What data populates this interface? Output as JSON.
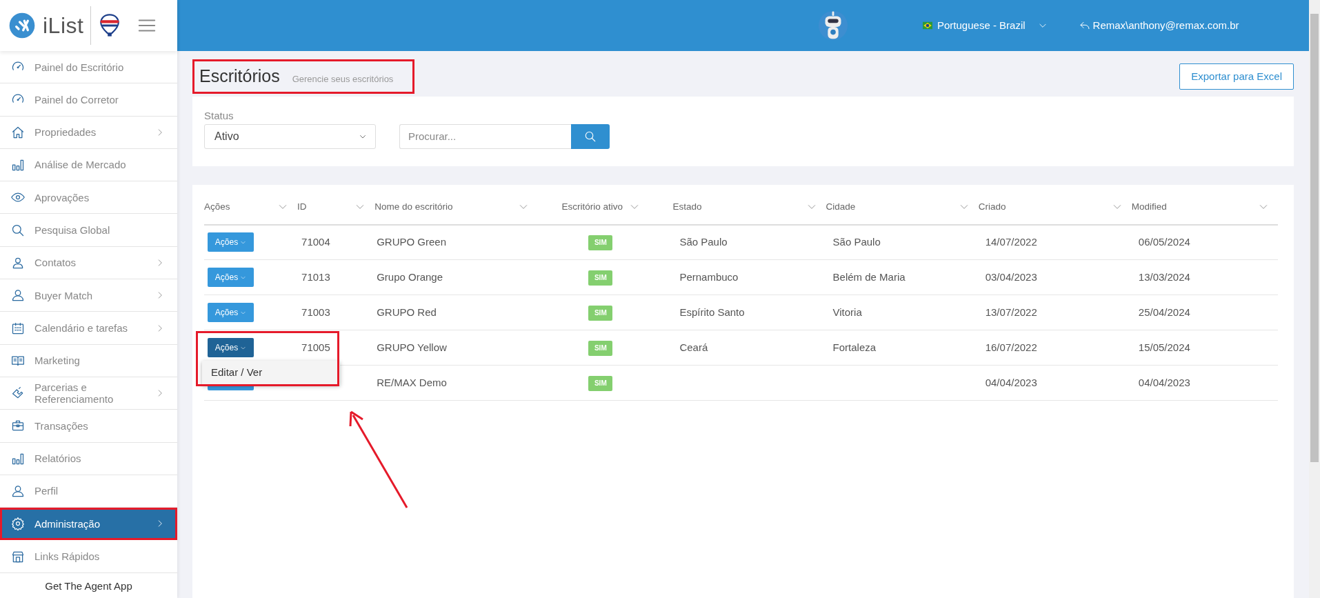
{
  "brand": {
    "name": "iList"
  },
  "sidebar": {
    "items": [
      {
        "label": "Painel do Escritório",
        "has_submenu": false,
        "selected": false,
        "highlighted": false
      },
      {
        "label": "Painel do Corretor",
        "has_submenu": false,
        "selected": false,
        "highlighted": false
      },
      {
        "label": "Propriedades",
        "has_submenu": true,
        "selected": false,
        "highlighted": false
      },
      {
        "label": "Análise de Mercado",
        "has_submenu": false,
        "selected": false,
        "highlighted": false
      },
      {
        "label": "Aprovações",
        "has_submenu": false,
        "selected": false,
        "highlighted": false
      },
      {
        "label": "Pesquisa Global",
        "has_submenu": false,
        "selected": false,
        "highlighted": false
      },
      {
        "label": "Contatos",
        "has_submenu": true,
        "selected": false,
        "highlighted": false
      },
      {
        "label": "Buyer Match",
        "has_submenu": true,
        "selected": false,
        "highlighted": false
      },
      {
        "label": "Calendário e tarefas",
        "has_submenu": true,
        "selected": false,
        "highlighted": false
      },
      {
        "label": "Marketing",
        "has_submenu": false,
        "selected": false,
        "highlighted": false
      },
      {
        "label": "Parcerias e Referenciamento",
        "has_submenu": true,
        "selected": false,
        "highlighted": false
      },
      {
        "label": "Transações",
        "has_submenu": false,
        "selected": false,
        "highlighted": false
      },
      {
        "label": "Relatórios",
        "has_submenu": false,
        "selected": false,
        "highlighted": false
      },
      {
        "label": "Perfil",
        "has_submenu": false,
        "selected": false,
        "highlighted": false
      },
      {
        "label": "Administração",
        "has_submenu": true,
        "selected": true,
        "highlighted": true
      },
      {
        "label": "Links Rápidos",
        "has_submenu": false,
        "selected": false,
        "highlighted": false
      }
    ],
    "footer": "Get The Agent App"
  },
  "topbar": {
    "language": "Portuguese - Brazil",
    "user": "Remax\\anthony@remax.com.br"
  },
  "page": {
    "title": "Escritórios",
    "subtitle": "Gerencie seus escritórios",
    "highlighted": true,
    "export_button": "Exportar para Excel"
  },
  "filters": {
    "status_label": "Status",
    "status_value": "Ativo",
    "search_placeholder": "Procurar..."
  },
  "table": {
    "columns": [
      "Ações",
      "ID",
      "Nome do escritório",
      "Escritório ativo",
      "Estado",
      "Cidade",
      "Criado",
      "Modified"
    ],
    "rows": [
      {
        "actions": "Ações",
        "id": "71004",
        "name": "GRUPO Green",
        "active": "SIM",
        "state": "São Paulo",
        "city": "São Paulo",
        "created": "14/07/2022",
        "modified": "06/05/2024",
        "menu_open": false
      },
      {
        "actions": "Ações",
        "id": "71013",
        "name": "Grupo Orange",
        "active": "SIM",
        "state": "Pernambuco",
        "city": "Belém de Maria",
        "created": "03/04/2023",
        "modified": "13/03/2024",
        "menu_open": false
      },
      {
        "actions": "Ações",
        "id": "71003",
        "name": "GRUPO Red",
        "active": "SIM",
        "state": "Espírito Santo",
        "city": "Vitoria",
        "created": "13/07/2022",
        "modified": "25/04/2024",
        "menu_open": false
      },
      {
        "actions": "Ações",
        "id": "71005",
        "name": "GRUPO Yellow",
        "active": "SIM",
        "state": "Ceará",
        "city": "Fortaleza",
        "created": "16/07/2022",
        "modified": "15/05/2024",
        "menu_open": true,
        "highlighted": true
      },
      {
        "name": "RE/MAX Demo",
        "active": "SIM",
        "created": "04/04/2023",
        "modified": "04/04/2023",
        "menu_open": false
      }
    ],
    "menu": {
      "items": [
        "Editar / Ver"
      ]
    }
  },
  "annotation_arrow": true
}
